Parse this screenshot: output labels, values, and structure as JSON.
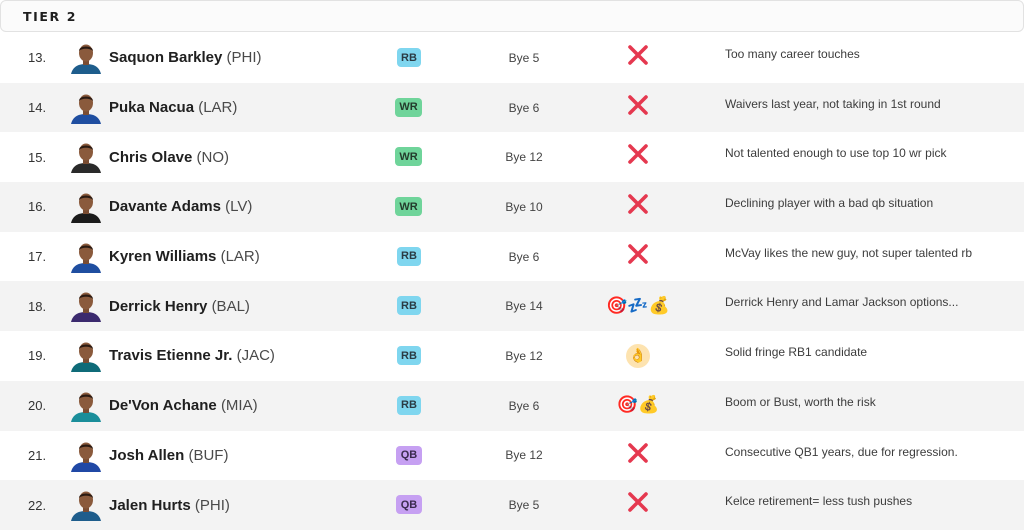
{
  "tier": {
    "label": "TIER 2"
  },
  "colors": {
    "rb": "#7fd6ef",
    "wr": "#6fd49a",
    "qb": "#c6a0f2",
    "x_mark": "#e5384f",
    "row_alt": "#f3f3f3"
  },
  "players": [
    {
      "rank": "13.",
      "name": "Saquon Barkley",
      "team": "(PHI)",
      "pos": "RB",
      "bye": "Bye 5",
      "verdict": "x",
      "note": "Too many career touches",
      "jersey": "#1e5d8c"
    },
    {
      "rank": "14.",
      "name": "Puka Nacua",
      "team": "(LAR)",
      "pos": "WR",
      "bye": "Bye 6",
      "verdict": "x",
      "note": "Waivers last year, not taking in 1st round",
      "jersey": "#1f4ea0"
    },
    {
      "rank": "15.",
      "name": "Chris Olave",
      "team": "(NO)",
      "pos": "WR",
      "bye": "Bye 12",
      "verdict": "x",
      "note": "Not talented enough to use top 10 wr pick",
      "jersey": "#2a2a2a"
    },
    {
      "rank": "16.",
      "name": "Davante Adams",
      "team": "(LV)",
      "pos": "WR",
      "bye": "Bye 10",
      "verdict": "x",
      "note": "Declining player with a bad qb situation",
      "jersey": "#1b1b1b"
    },
    {
      "rank": "17.",
      "name": "Kyren Williams",
      "team": "(LAR)",
      "pos": "RB",
      "bye": "Bye 6",
      "verdict": "x",
      "note": "McVay likes the new guy, not super talented rb",
      "jersey": "#1f4ea0"
    },
    {
      "rank": "18.",
      "name": "Derrick Henry",
      "team": "(BAL)",
      "pos": "RB",
      "bye": "Bye 14",
      "verdict": "target-sleep-money",
      "note": "Derrick Henry and Lamar Jackson options...",
      "jersey": "#3b2a6e"
    },
    {
      "rank": "19.",
      "name": "Travis Etienne Jr.",
      "team": "(JAC)",
      "pos": "RB",
      "bye": "Bye 12",
      "verdict": "ok",
      "note": "Solid fringe RB1 candidate",
      "jersey": "#0f6b78"
    },
    {
      "rank": "20.",
      "name": "De'Von Achane",
      "team": "(MIA)",
      "pos": "RB",
      "bye": "Bye 6",
      "verdict": "target-money",
      "note": "Boom or Bust, worth the risk",
      "jersey": "#1a8e9a"
    },
    {
      "rank": "21.",
      "name": "Josh Allen",
      "team": "(BUF)",
      "pos": "QB",
      "bye": "Bye 12",
      "verdict": "x",
      "note": "Consecutive QB1 years, due for regression.",
      "jersey": "#2048a5"
    },
    {
      "rank": "22.",
      "name": "Jalen Hurts",
      "team": "(PHI)",
      "pos": "QB",
      "bye": "Bye 5",
      "verdict": "x",
      "note": "Kelce retirement= less tush pushes",
      "jersey": "#1e5d8c"
    }
  ]
}
